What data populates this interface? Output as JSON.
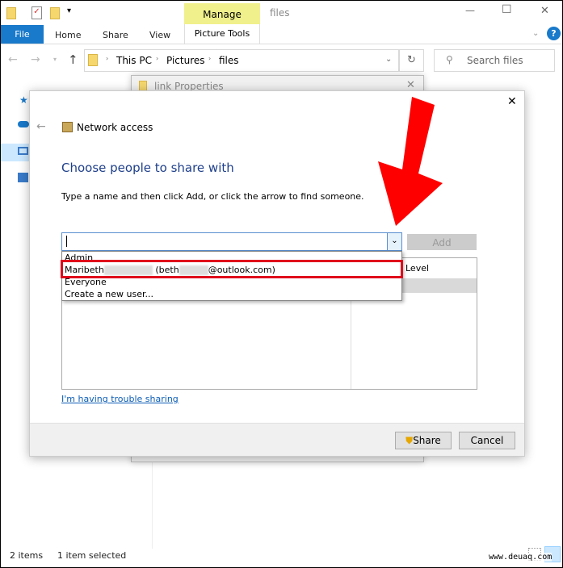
{
  "window": {
    "title": "files",
    "manage_tab": "Manage",
    "picture_tools_tab": "Picture Tools",
    "tabs": [
      "File",
      "Home",
      "Share",
      "View"
    ],
    "minimize": "—",
    "maximize": "☐",
    "close": "✕",
    "help": "?"
  },
  "address": {
    "crumbs": [
      "This PC",
      "Pictures",
      "files"
    ],
    "search_placeholder": "Search files"
  },
  "back_dialog": {
    "title": "link Properties"
  },
  "dialog": {
    "close": "✕",
    "header": "Network access",
    "heading": "Choose people to share with",
    "instruction": "Type a name and then click Add, or click the arrow to find someone.",
    "input_value": "",
    "add_label": "Add",
    "column_level": "Level",
    "dropdown_items": [
      "Admin",
      "Maribeth",
      "Everyone",
      "Create a new user..."
    ],
    "maribeth_email_prefix": "(beth",
    "maribeth_email_suffix": "@outlook.com)",
    "trouble_link": "I'm having trouble sharing",
    "share_label": "Share",
    "cancel_label": "Cancel"
  },
  "status": {
    "items": "2 items",
    "selected": "1 item selected"
  },
  "watermark": "www.deuaq.com",
  "colors": {
    "accent": "#1979ca",
    "heading": "#1e3f8a",
    "highlight_box": "#e0001b",
    "arrow": "#ff0000",
    "manage": "#f0f08c"
  }
}
